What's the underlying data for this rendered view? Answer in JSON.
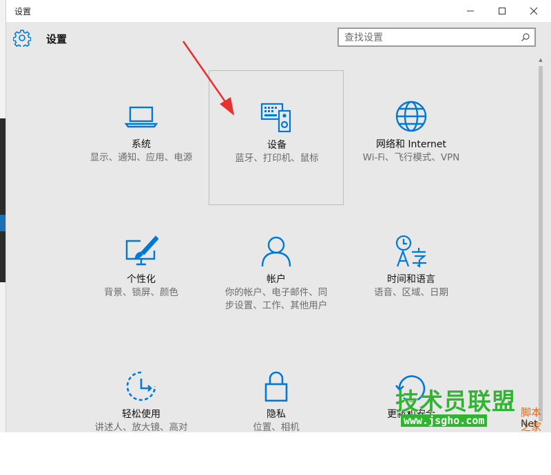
{
  "window": {
    "title": "设置",
    "minimize": "—",
    "maximize": "☐",
    "close": "✕"
  },
  "header": {
    "title": "设置"
  },
  "search": {
    "placeholder": "查找设置"
  },
  "tiles": [
    {
      "name": "系统",
      "desc": "显示、通知、应用、电源",
      "icon": "laptop-icon"
    },
    {
      "name": "设备",
      "desc": "蓝牙、打印机、鼠标",
      "icon": "devices-icon",
      "selected": true
    },
    {
      "name": "网络和 Internet",
      "desc": "Wi-Fi、飞行模式、VPN",
      "icon": "globe-icon"
    },
    {
      "name": "个性化",
      "desc": "背景、锁屏、颜色",
      "icon": "personalization-icon"
    },
    {
      "name": "帐户",
      "desc": "你的帐户、电子邮件、同步设置、工作、其他用户",
      "icon": "person-icon"
    },
    {
      "name": "时间和语言",
      "desc": "语音、区域、日期",
      "icon": "time-language-icon"
    },
    {
      "name": "轻松使用",
      "desc": "讲述人、放大镜、高对",
      "icon": "ease-of-access-icon"
    },
    {
      "name": "隐私",
      "desc": "位置、相机",
      "icon": "lock-icon"
    },
    {
      "name": "更新和安全",
      "desc": "",
      "icon": "update-icon"
    }
  ],
  "watermark": {
    "main": "技术员联盟",
    "url": "www.jsgho.com",
    "side": "脚本之家",
    "net": "Net"
  },
  "colors": {
    "accent": "#0078d7",
    "arrow": "#e8312f",
    "watermark": "#2fb52f",
    "background": "#e8e8e8"
  }
}
